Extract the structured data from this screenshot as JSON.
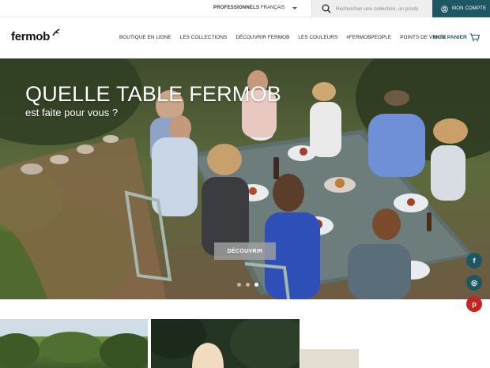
{
  "topbar": {
    "professionals": "PROFESSIONNELS",
    "language": "FRANÇAIS",
    "search_placeholder": "Rechercher une collection, un produ",
    "account": "MON COMPTE"
  },
  "header": {
    "logo": "fermob",
    "nav": [
      "BOUTIQUE EN LIGNE",
      "LES COLLECTIONS",
      "DÉCOUVRIR FERMOB",
      "LES COULEURS",
      "#FERMOBPEOPLE",
      "POINTS DE VENTE"
    ],
    "cart": "MON PANIER"
  },
  "hero": {
    "title": "QUELLE TABLE FERMOB",
    "subtitle": "est faite pour vous ?",
    "button": "DÉCOUVRIR",
    "active_slide": 3,
    "slide_count": 3
  },
  "social": {
    "facebook": "f",
    "instagram": "◎",
    "pinterest": "p"
  },
  "colors": {
    "accent": "#1d5862",
    "pinterest": "#c8231f"
  }
}
